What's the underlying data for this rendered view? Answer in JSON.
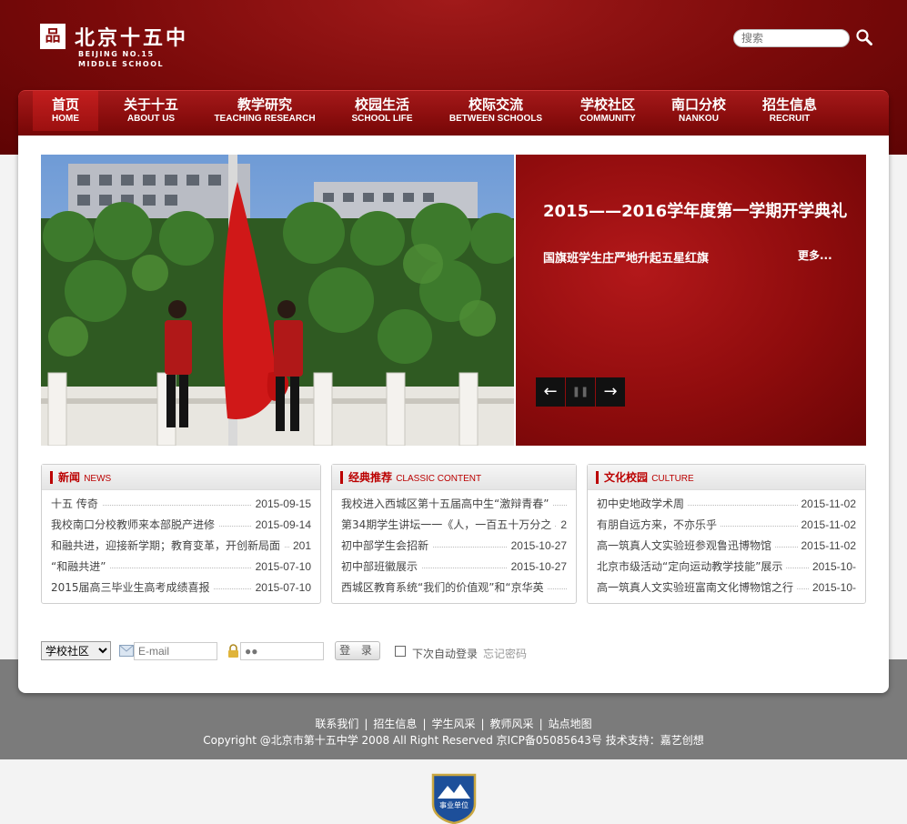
{
  "header": {
    "logo_cn": "北京十五中",
    "logo_en_line1": "BEIJING NO.15",
    "logo_en_line2": "MIDDLE SCHOOL",
    "logo_mark": "品",
    "search_placeholder": "搜索",
    "search_icon": "magnifier-icon"
  },
  "nav": [
    {
      "cn": "首页",
      "en": "HOME"
    },
    {
      "cn": "关于十五",
      "en": "ABOUT US"
    },
    {
      "cn": "教学研究",
      "en": "TEACHING RESEARCH"
    },
    {
      "cn": "校园生活",
      "en": "SCHOOL LIFE"
    },
    {
      "cn": "校际交流",
      "en": "BETWEEN SCHOOLS"
    },
    {
      "cn": "学校社区",
      "en": "COMMUNITY"
    },
    {
      "cn": "南口分校",
      "en": "NANKOU"
    },
    {
      "cn": "招生信息",
      "en": "RECRUIT"
    }
  ],
  "banner": {
    "title": "2015——2016学年度第一学期开学典礼",
    "subtitle": "国旗班学生庄严地升起五星红旗",
    "more": "更多...",
    "prev_icon": "←",
    "pause_icon": "❚❚",
    "next_icon": "→"
  },
  "boxes": [
    {
      "title": "新闻",
      "sub": "NEWS",
      "items": [
        {
          "t": "十五 传奇",
          "d": "2015-09-15"
        },
        {
          "t": "我校南口分校教师来本部脱产进修",
          "d": "2015-09-14"
        },
        {
          "t": "和融共进，迎接新学期；教育变革，开创新局面",
          "d": "201"
        },
        {
          "t": "“和融共进”",
          "d": "2015-07-10"
        },
        {
          "t": "2015届高三毕业生高考成绩喜报",
          "d": "2015-07-10"
        }
      ]
    },
    {
      "title": "经典推荐",
      "sub": "CLASSIC CONTENT",
      "items": [
        {
          "t": "我校进入西城区第十五届高中生“激辩青春”",
          "d": ""
        },
        {
          "t": "第34期学生讲坛一一《人，一百五十万分之",
          "d": "2"
        },
        {
          "t": "初中部学生会招新",
          "d": "2015-10-27"
        },
        {
          "t": "初中部班徽展示",
          "d": "2015-10-27"
        },
        {
          "t": "西城区教育系统“我们的价值观”和“京华英",
          "d": ""
        }
      ]
    },
    {
      "title": "文化校园",
      "sub": "CULTURE",
      "items": [
        {
          "t": "初中史地政学术周",
          "d": "2015-11-02"
        },
        {
          "t": "有朋自远方来，不亦乐乎",
          "d": "2015-11-02"
        },
        {
          "t": "高一筑真人文实验班参观鲁迅博物馆",
          "d": "2015-11-02"
        },
        {
          "t": "北京市级活动“定向运动教学技能”展示",
          "d": "2015-10-"
        },
        {
          "t": "高一筑真人文实验班富南文化博物馆之行",
          "d": "2015-10-"
        }
      ]
    }
  ],
  "login": {
    "select_value": "学校社区",
    "email_placeholder": "E-mail",
    "password_placeholder": "●●",
    "button": "登 录",
    "remember": "下次自动登录",
    "forgot": "忘记密码"
  },
  "footer": {
    "links": [
      "联系我们",
      "招生信息",
      "学生风采",
      "教师风采",
      "站点地图"
    ],
    "separator": "|",
    "copyright": "Copyright @北京市第十五中学 2008 All Right Reserved 京ICP备05085643号  技术支持：嘉艺创想",
    "badge_text": "事业单位"
  },
  "colors": {
    "brand_red": "#8c0e0e",
    "accent_red": "#b00000",
    "footer_gray": "#7b7b7b"
  }
}
